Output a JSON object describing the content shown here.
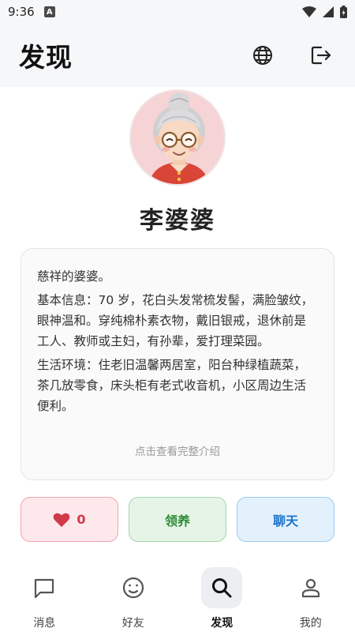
{
  "status_bar": {
    "time": "9:36",
    "indicator": "A"
  },
  "header": {
    "title": "发现",
    "language_icon": "globe-icon",
    "logout_icon": "logout-icon"
  },
  "profile": {
    "name": "李婆婆",
    "intro": [
      "慈祥的婆婆。",
      "基本信息：70 岁，花白头发常梳发髻，满脸皱纹，眼神温和。穿纯棉朴素衣物，戴旧银戒，退休前是工人、教师或主妇，有孙辈，爱打理菜园。",
      "生活环境：住老旧温馨两居室，阳台种绿植蔬菜，茶几放零食，床头柜有老式收音机，小区周边生活便利。"
    ],
    "view_more": "点击查看完整介绍"
  },
  "actions": {
    "like_count": "0",
    "adopt_label": "领养",
    "chat_label": "聊天"
  },
  "nav": [
    {
      "label": "消息",
      "icon": "message-icon"
    },
    {
      "label": "好友",
      "icon": "smiley-icon"
    },
    {
      "label": "发现",
      "icon": "search-icon",
      "active": true
    },
    {
      "label": "我的",
      "icon": "person-icon"
    }
  ],
  "colors": {
    "like": "#d13a48",
    "adopt": "#2e8b36",
    "chat": "#1d73c8"
  }
}
